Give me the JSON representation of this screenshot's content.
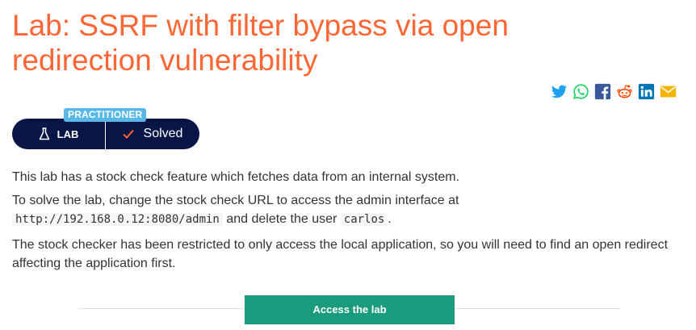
{
  "lab": {
    "title": "Lab: SSRF with filter bypass via open redirection vulnerability",
    "level": "PRACTITIONER",
    "type_label": "LAB",
    "status": "Solved"
  },
  "share_icons": [
    "twitter-icon",
    "whatsapp-icon",
    "facebook-icon",
    "reddit-icon",
    "linkedin-icon",
    "email-icon"
  ],
  "colors": {
    "title": "#ff6633",
    "level_tag": "#58b8e8",
    "status_pill": "#0a1547",
    "check": "#ff6633",
    "button": "#1b9b7d",
    "twitter": "#1da1f2",
    "whatsapp": "#25d366",
    "facebook": "#3b5998",
    "reddit": "#ff4500",
    "linkedin": "#0077b5",
    "email": "#f4b400"
  },
  "description": {
    "p1": "This lab has a stock check feature which fetches data from an internal system.",
    "p2_a": "To solve the lab, change the stock check URL to access the admin interface at",
    "p2_url": "http://192.168.0.12:8080/admin",
    "p2_b": " and delete the user ",
    "p2_user": "carlos",
    "p2_c": ".",
    "p3": "The stock checker has been restricted to only access the local application, so you will need to find an open redirect affecting the application first."
  },
  "access_button_label": "Access the lab"
}
